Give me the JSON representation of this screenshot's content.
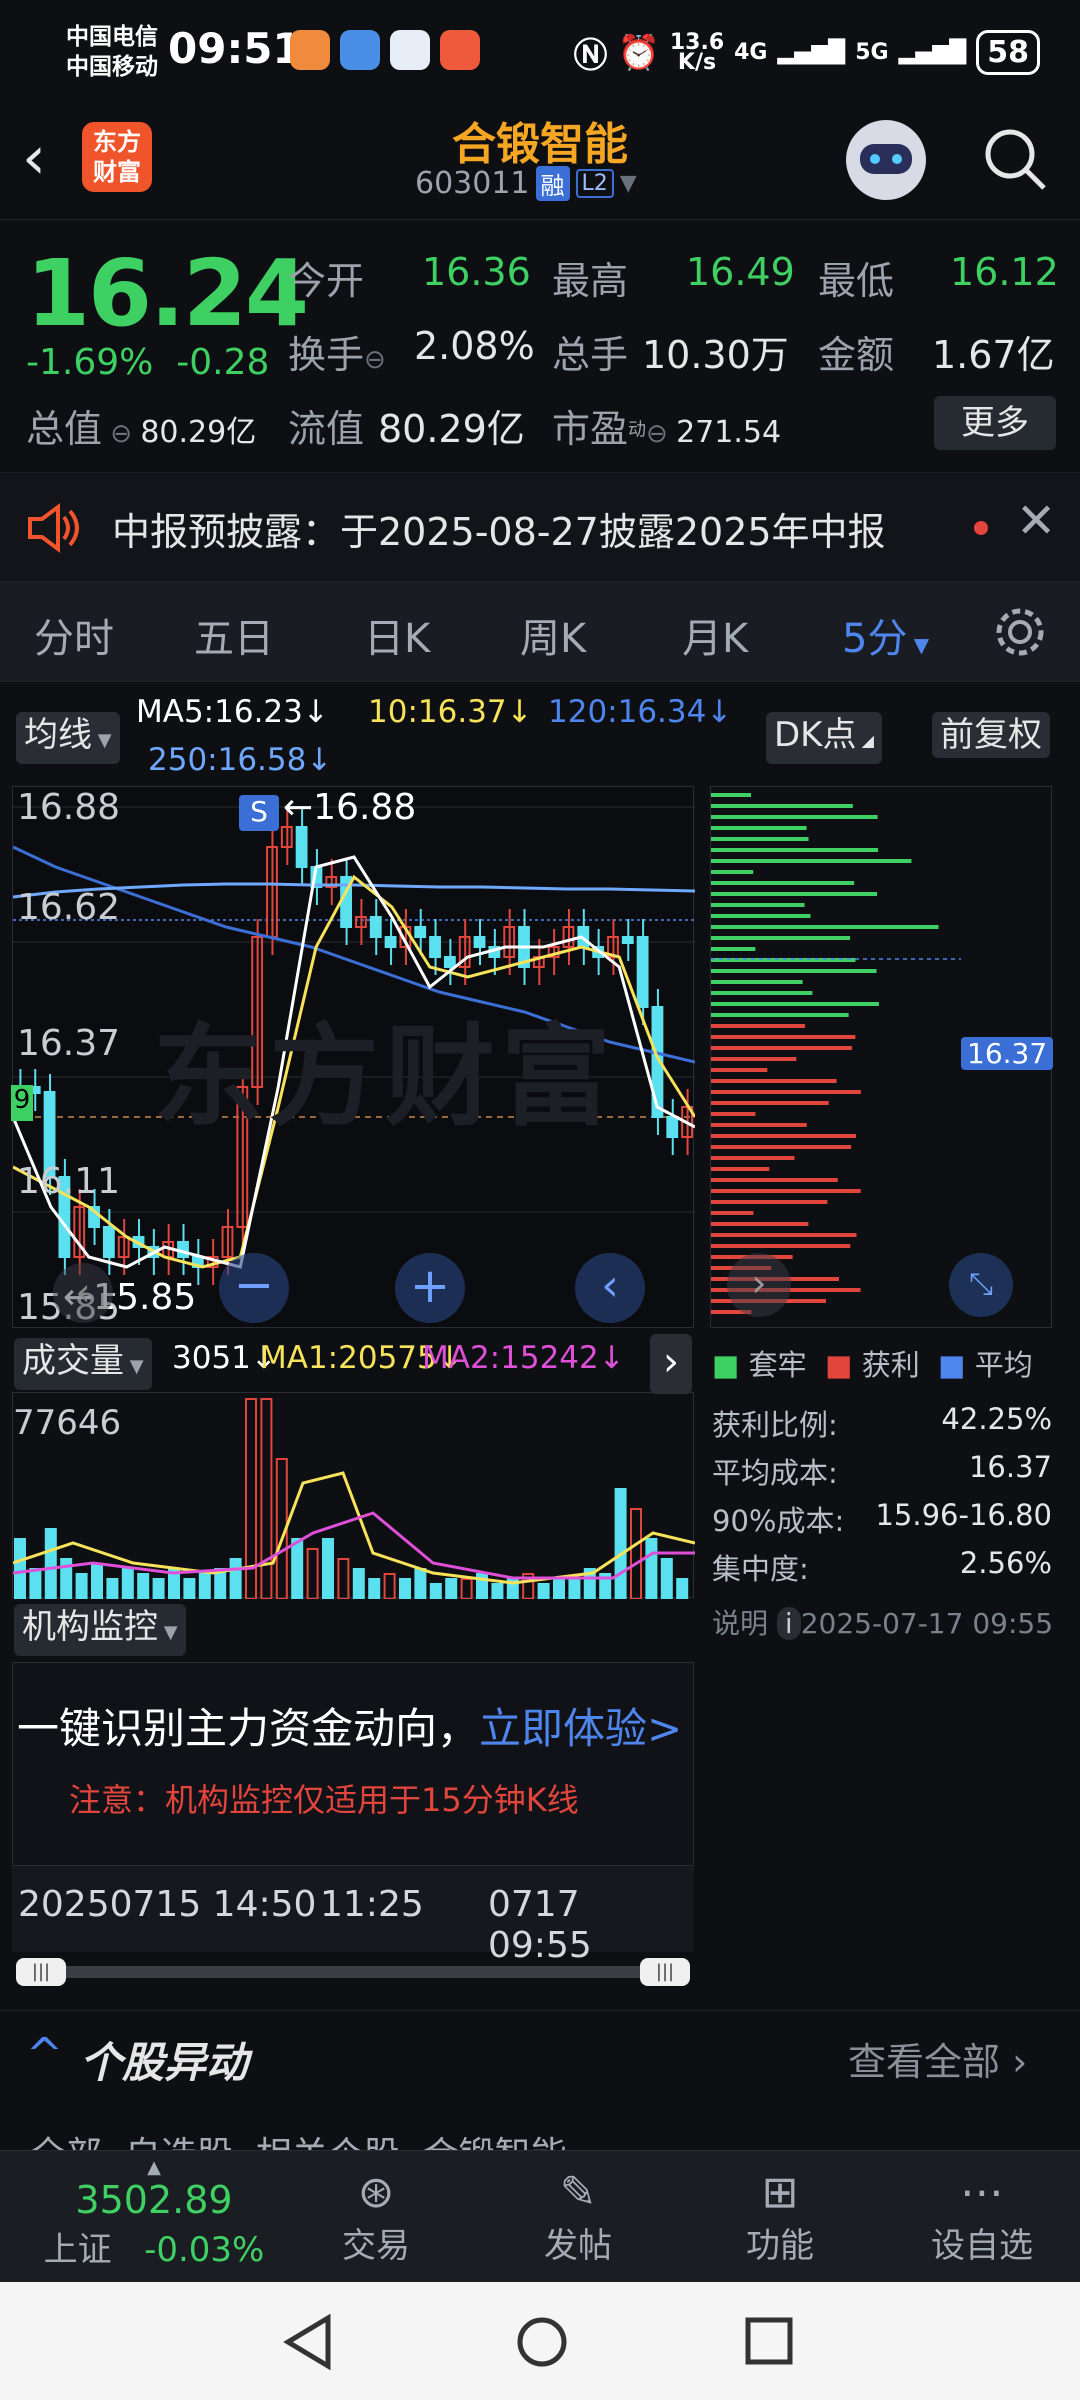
{
  "status": {
    "carrier1": "中国电信",
    "carrier2": "中国移动",
    "time": "09:51",
    "speed_top": "13.6",
    "speed_bot": "K/s",
    "net1": "4G",
    "net2": "5G",
    "battery": "58"
  },
  "header": {
    "logo_top": "东方",
    "logo_bot": "财富",
    "title": "合锻智能",
    "code": "603011",
    "tag1": "融",
    "tag2": "L2"
  },
  "quote": {
    "price": "16.24",
    "pct": "-1.69%",
    "chg": "-0.28",
    "open_l": "今开",
    "open_v": "16.36",
    "high_l": "最高",
    "high_v": "16.49",
    "low_l": "最低",
    "low_v": "16.12",
    "turn_l": "换手",
    "turn_v": "2.08%",
    "vol_l": "总手",
    "vol_v": "10.30万",
    "amt_l": "金额",
    "amt_v": "1.67亿",
    "mcap_l": "总值",
    "mcap_v": "80.29亿",
    "flt_l": "流值",
    "flt_v": "80.29亿",
    "pe_l": "市盈",
    "pe_sup": "动",
    "pe_v": "271.54",
    "more": "更多"
  },
  "notice": {
    "text": "中报预披露：于2025-08-27披露2025年中报"
  },
  "tabs": [
    "分时",
    "五日",
    "日K",
    "周K",
    "月K",
    "5分"
  ],
  "ma": {
    "btn": "均线",
    "ma5": "MA5:16.23↓",
    "ma10": "10:16.37↓",
    "ma120": "120:16.34↓",
    "ma250": "250:16.58↓",
    "dk": "DK点",
    "fq": "前复权"
  },
  "price_axis": {
    "y1": "16.88",
    "y2": "16.62",
    "y3": "16.37",
    "y4": "16.11",
    "y5": "15.85",
    "hi": "16.88",
    "lo": "15.85",
    "s": "S",
    "edge": "9"
  },
  "vol": {
    "btn": "成交量",
    "v": "3051↓",
    "ma1": "MA1:20575↓",
    "ma2": "MA2:15242↓",
    "top": "77646"
  },
  "inst": {
    "btn": "机构监控",
    "line1": "一键识别主力资金动向，",
    "link": "立即体验>",
    "note": "注意：机构监控仅适用于15分钟K线"
  },
  "time_axis": {
    "t1": "20250715 14:50",
    "t2": "11:25",
    "t3": "0717 09:55"
  },
  "chips": {
    "avg": "16.37",
    "leg1": "套牢",
    "leg2": "获利",
    "leg3": "平均",
    "s1l": "获利比例:",
    "s1v": "42.25%",
    "s2l": "平均成本:",
    "s2v": "16.37",
    "s3l": "90%成本:",
    "s3v": "15.96-16.80",
    "s4l": "集中度:",
    "s4v": "2.56%",
    "note": "说明",
    "date": "2025-07-17 09:55"
  },
  "section": {
    "title": "个股异动",
    "all": "查看全部",
    "tabs": "全部  自选股  相关个股  合锻智能"
  },
  "bottom": {
    "idx_v": "3502.89",
    "idx_n": "上证",
    "idx_c": "-0.03%",
    "n1": "交易",
    "n2": "发帖",
    "n3": "功能",
    "n4": "设自选"
  },
  "colors": {
    "up": "#e2453c",
    "down": "#3fd063",
    "accent": "#4f86ee",
    "title": "#f5a623"
  }
}
